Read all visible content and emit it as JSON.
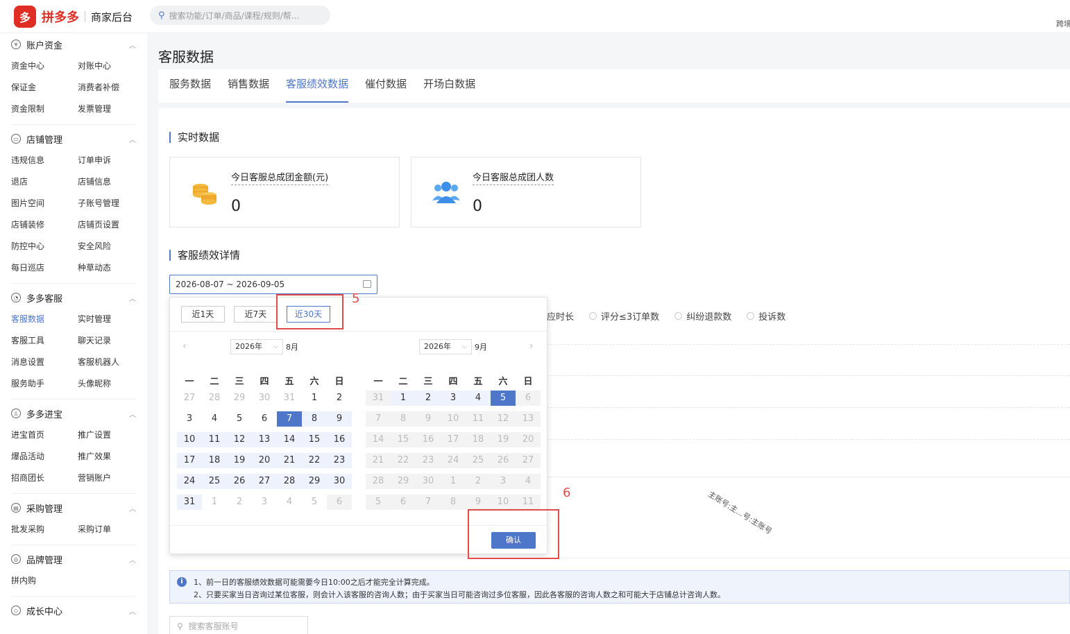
{
  "topbar": {
    "logo_mark": "多",
    "logo_text": "拼多多",
    "logo_sub": "商家后台",
    "search_placeholder": "搜索功能/订单/商品/课程/规则/帮...",
    "right_text": "跨境"
  },
  "sidebar": {
    "groups": [
      {
        "title": "账户资金",
        "items": [
          "资金中心",
          "对账中心",
          "保证金",
          "消费者补偿",
          "资金限制",
          "发票管理"
        ]
      },
      {
        "title": "店铺管理",
        "items": [
          "违规信息",
          "订单申诉",
          "退店",
          "店铺信息",
          "图片空间",
          "子账号管理",
          "店铺装修",
          "店铺页设置",
          "防控中心",
          "安全风险",
          "每日巡店",
          "种草动态"
        ]
      },
      {
        "title": "多多客服",
        "items": [
          "客服数据",
          "实时管理",
          "客服工具",
          "聊天记录",
          "消息设置",
          "客服机器人",
          "服务助手",
          "头像昵称"
        ]
      },
      {
        "title": "多多进宝",
        "items": [
          "进宝首页",
          "推广设置",
          "爆品活动",
          "推广效果",
          "招商团长",
          "营销账户"
        ]
      },
      {
        "title": "采购管理",
        "items": [
          "批发采购",
          "采购订单"
        ]
      },
      {
        "title": "品牌管理",
        "items": [
          "拼内购"
        ]
      },
      {
        "title": "成长中心",
        "items": []
      }
    ]
  },
  "main": {
    "page_title": "客服数据",
    "tabs": [
      "服务数据",
      "销售数据",
      "客服绩效数据",
      "催付数据",
      "开场白数据"
    ],
    "realtime_title": "实时数据",
    "cards": [
      {
        "label": "今日客服总成团金额(元)",
        "value": "0",
        "icon": "coins-icon"
      },
      {
        "label": "今日客服总成团人数",
        "value": "0",
        "icon": "users-icon"
      }
    ],
    "detail_title": "客服绩效详情",
    "date_range": "2026-08-07 ~ 2026-09-05",
    "filters": [
      "应时长",
      "评分≤3订单数",
      "纠纷退款数",
      "投诉数"
    ],
    "axis_label": "主账号:主...号:主账号",
    "notice_line1": "1、前一日的客服绩效数据可能需要今日10:00之后才能完全计算完成。",
    "notice_line2": "2、只要买家当日咨询过某位客服，则会计入该客服的咨询人数；由于买家当日可能咨询过多位客服，因此各客服的咨询人数之和可能大于店铺总计咨询人数。",
    "search_account_placeholder": "搜索客服账号"
  },
  "picker": {
    "quick": [
      "近1天",
      "近7天",
      "近30天"
    ],
    "left_year": "2026年",
    "left_month": "8月",
    "right_year": "2026年",
    "right_month": "9月",
    "weekdays": [
      "一",
      "二",
      "三",
      "四",
      "五",
      "六",
      "日"
    ],
    "left_days": [
      [
        "27",
        "28",
        "29",
        "30",
        "31",
        "1",
        "2"
      ],
      [
        "3",
        "4",
        "5",
        "6",
        "7",
        "8",
        "9"
      ],
      [
        "10",
        "11",
        "12",
        "13",
        "14",
        "15",
        "16"
      ],
      [
        "17",
        "18",
        "19",
        "20",
        "21",
        "22",
        "23"
      ],
      [
        "24",
        "25",
        "26",
        "27",
        "28",
        "29",
        "30"
      ],
      [
        "31",
        "1",
        "2",
        "3",
        "4",
        "5",
        "6"
      ]
    ],
    "right_days": [
      [
        "31",
        "1",
        "2",
        "3",
        "4",
        "5",
        "6"
      ],
      [
        "7",
        "8",
        "9",
        "10",
        "11",
        "12",
        "13"
      ],
      [
        "14",
        "15",
        "16",
        "17",
        "18",
        "19",
        "20"
      ],
      [
        "21",
        "22",
        "23",
        "24",
        "25",
        "26",
        "27"
      ],
      [
        "28",
        "29",
        "30",
        "1",
        "2",
        "3",
        "4"
      ],
      [
        "5",
        "6",
        "7",
        "8",
        "9",
        "10",
        "11"
      ]
    ],
    "confirm": "确认"
  },
  "annotations": {
    "step5": "5",
    "step6": "6",
    "color": "#e24a4a"
  },
  "colors": {
    "accent": "#4e76c9",
    "brand": "#e02e24"
  }
}
